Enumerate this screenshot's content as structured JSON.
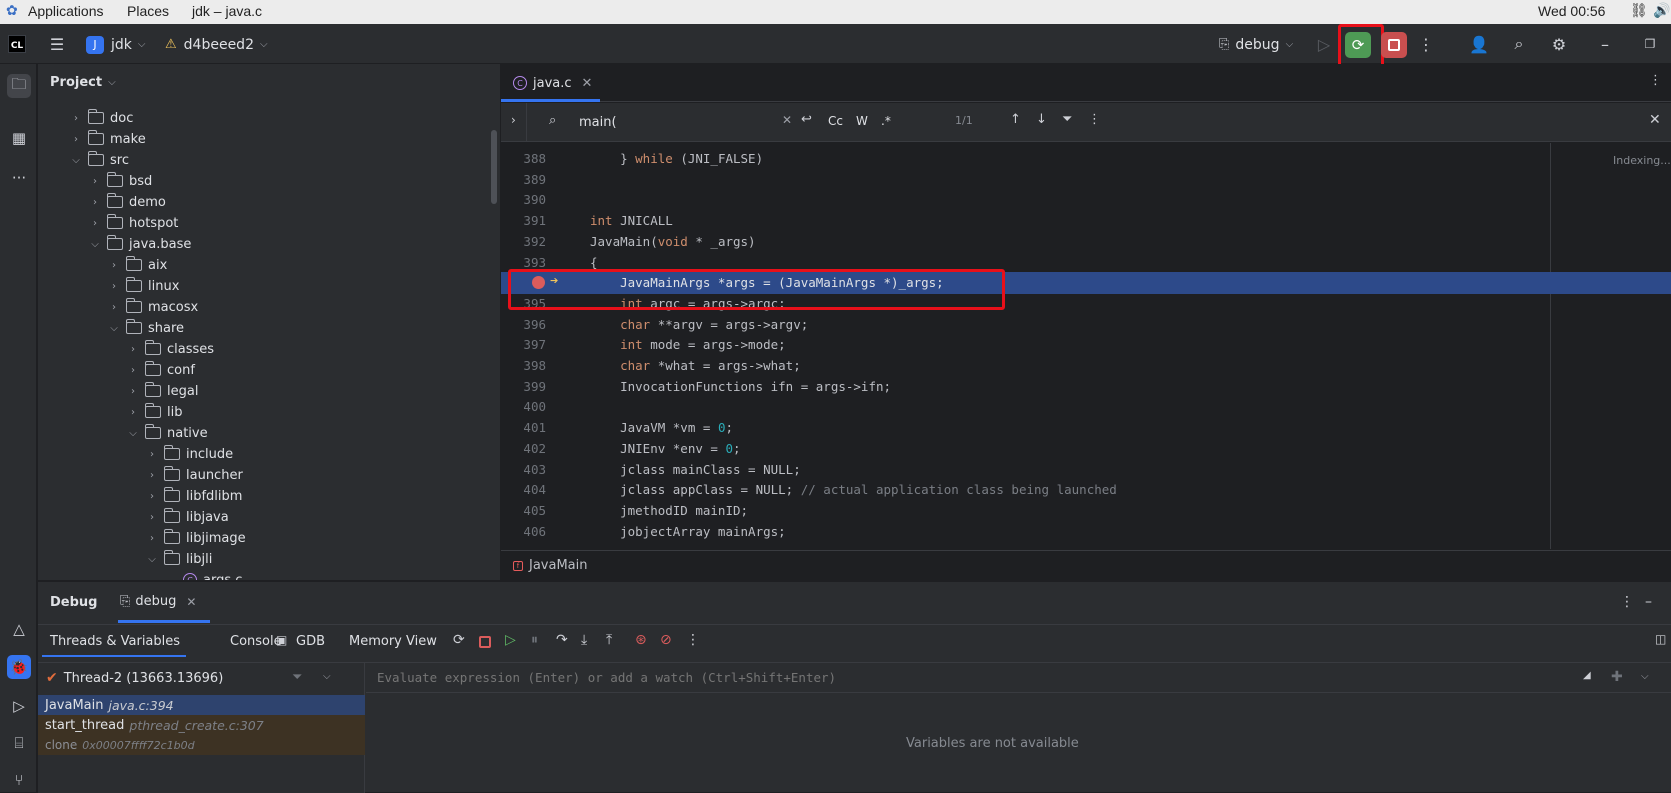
{
  "gnome": {
    "applications": "Applications",
    "places": "Places",
    "window_title": "jdk – java.c",
    "clock": "Wed 00:56"
  },
  "header": {
    "app_logo": "CL",
    "project_initial": "J",
    "project_name": "jdk",
    "branch": "d4beeed2",
    "run_config": "debug"
  },
  "project_panel": {
    "title": "Project",
    "tree": [
      {
        "label": "doc",
        "depth": 0,
        "expanded": false
      },
      {
        "label": "make",
        "depth": 0,
        "expanded": false
      },
      {
        "label": "src",
        "depth": 0,
        "expanded": true
      },
      {
        "label": "bsd",
        "depth": 1,
        "expanded": false
      },
      {
        "label": "demo",
        "depth": 1,
        "expanded": false
      },
      {
        "label": "hotspot",
        "depth": 1,
        "expanded": false
      },
      {
        "label": "java.base",
        "depth": 1,
        "expanded": true
      },
      {
        "label": "aix",
        "depth": 2,
        "expanded": false
      },
      {
        "label": "linux",
        "depth": 2,
        "expanded": false
      },
      {
        "label": "macosx",
        "depth": 2,
        "expanded": false
      },
      {
        "label": "share",
        "depth": 2,
        "expanded": true
      },
      {
        "label": "classes",
        "depth": 3,
        "expanded": false
      },
      {
        "label": "conf",
        "depth": 3,
        "expanded": false
      },
      {
        "label": "legal",
        "depth": 3,
        "expanded": false
      },
      {
        "label": "lib",
        "depth": 3,
        "expanded": false
      },
      {
        "label": "native",
        "depth": 3,
        "expanded": true
      },
      {
        "label": "include",
        "depth": 4,
        "expanded": false
      },
      {
        "label": "launcher",
        "depth": 4,
        "expanded": false
      },
      {
        "label": "libfdlibm",
        "depth": 4,
        "expanded": false
      },
      {
        "label": "libjava",
        "depth": 4,
        "expanded": false
      },
      {
        "label": "libjimage",
        "depth": 4,
        "expanded": false
      },
      {
        "label": "libjli",
        "depth": 4,
        "expanded": true
      },
      {
        "label": "args.c",
        "depth": 5,
        "expanded": false,
        "file": true
      }
    ]
  },
  "editor": {
    "tab_label": "java.c",
    "search_query": "main(",
    "match_case": "Cc",
    "words": "W",
    "regex": ".*",
    "match_count": "1/1",
    "indexing": "Indexing...",
    "breadcrumb": "JavaMain",
    "lines": [
      {
        "n": "388",
        "html": "    } <span class=\"kw\">while</span> (JNI_FALSE)"
      },
      {
        "n": "389",
        "html": ""
      },
      {
        "n": "390",
        "html": ""
      },
      {
        "n": "391",
        "html": "<span class=\"kw\">int</span> JNICALL"
      },
      {
        "n": "392",
        "html": "JavaMain(<span class=\"kw\">void</span> * _args)"
      },
      {
        "n": "393",
        "html": "{"
      },
      {
        "n": "394",
        "html": "    JavaMainArgs *args = (JavaMainArgs *)_args;"
      },
      {
        "n": "395",
        "html": "    <span class=\"kw\">int</span> argc = args->argc;"
      },
      {
        "n": "396",
        "html": "    <span class=\"kw\">char</span> **argv = args->argv;"
      },
      {
        "n": "397",
        "html": "    <span class=\"kw\">int</span> mode = args->mode;"
      },
      {
        "n": "398",
        "html": "    <span class=\"kw\">char</span> *what = args->what;"
      },
      {
        "n": "399",
        "html": "    InvocationFunctions ifn = args->ifn;"
      },
      {
        "n": "400",
        "html": ""
      },
      {
        "n": "401",
        "html": "    JavaVM *vm = <span class=\"num\">0</span>;"
      },
      {
        "n": "402",
        "html": "    JNIEnv *env = <span class=\"num\">0</span>;"
      },
      {
        "n": "403",
        "html": "    jclass mainClass = NULL;"
      },
      {
        "n": "404",
        "html": "    jclass appClass = NULL; <span class=\"cmt\">// actual application class being launched</span>"
      },
      {
        "n": "405",
        "html": "    jmethodID mainID;"
      },
      {
        "n": "406",
        "html": "    jobjectArray mainArgs;"
      }
    ]
  },
  "debug": {
    "title": "Debug",
    "session_tab": "debug",
    "tabs": [
      "Threads & Variables",
      "Console",
      "GDB",
      "Memory View"
    ],
    "thread": "Thread-2 (13663.13696)",
    "frames": [
      {
        "fn": "JavaMain",
        "loc": "java.c:394"
      },
      {
        "fn": "start_thread",
        "loc": "pthread_create.c:307"
      },
      {
        "fn": "clone",
        "loc": "0x00007ffff72c1b0d"
      }
    ],
    "eval_placeholder": "Evaluate expression (Enter) or add a watch (Ctrl+Shift+Enter)",
    "vars_empty": "Variables are not available"
  }
}
